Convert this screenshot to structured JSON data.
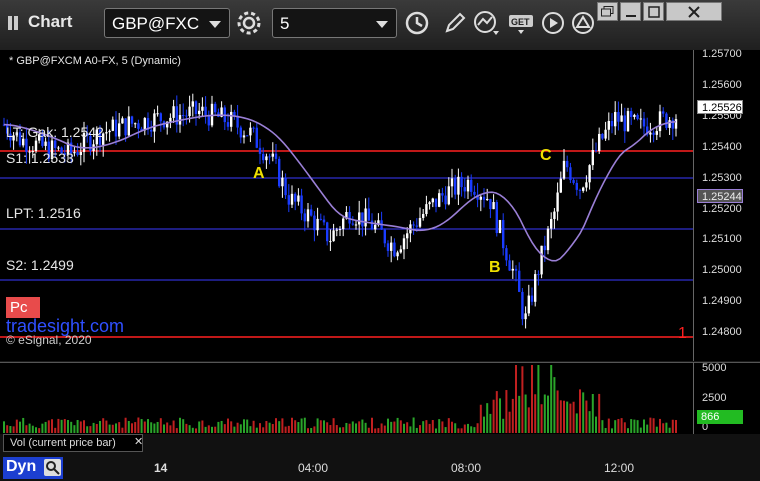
{
  "window": {
    "title": "Chart"
  },
  "toolbar": {
    "symbol": "GBP@FXC",
    "interval": "5"
  },
  "chart_data": {
    "type": "candlestick",
    "title": "* GBP@FXCM A0-FX, 5 (Dynamic)",
    "y_axis": {
      "min": 1.2475,
      "max": 1.2575,
      "ticks": [
        "1.25700",
        "1.25600",
        "1.25500",
        "1.25400",
        "1.25300",
        "1.25200",
        "1.25100",
        "1.25000",
        "1.24900",
        "1.24800"
      ]
    },
    "x_axis": {
      "ticks": [
        "14",
        "04:00",
        "08:00",
        "12:00"
      ]
    },
    "price_labels": {
      "last_price": "1.25526",
      "moving_average": "1.25244"
    },
    "levels": [
      {
        "label": "LT: Gak: 1.2542",
        "value": 1.2542,
        "color": "#ff2020"
      },
      {
        "label": "S1: 1.2533",
        "value": 1.2533,
        "color": "#3a3aff"
      },
      {
        "label": "LPT: 1.2516",
        "value": 1.2516,
        "color": "#3a3aff"
      },
      {
        "label": "S2: 1.2499",
        "value": 1.2499,
        "color": "#3a3aff"
      },
      {
        "label": "1",
        "value": 1.248,
        "color": "#ff2020"
      }
    ],
    "annotations": [
      "A",
      "B",
      "C"
    ],
    "colors": {
      "up": "#ffffff",
      "down": "#1a3cff",
      "ma": "#9a7fd6"
    },
    "volume": {
      "label": "Vol (current price bar)",
      "ticks": [
        "5000",
        "2500",
        "0"
      ],
      "last": "866",
      "colors": {
        "up": "#2aa52a",
        "down": "#c02020"
      }
    }
  },
  "overlays": {
    "pc_label": "Pc",
    "watermark": "tradesight.com",
    "copyright": "© eSignal, 2020"
  },
  "statusbar": {
    "dyn_label": "Dyn"
  },
  "icons": [
    "chart-icon",
    "settings-gear-icon",
    "clock-icon",
    "pencil-icon",
    "indicator-icon",
    "get-icon",
    "play-icon",
    "alert-icon",
    "restore-icon",
    "minimize-icon",
    "maximize-icon",
    "close-icon",
    "zoom-icon"
  ]
}
